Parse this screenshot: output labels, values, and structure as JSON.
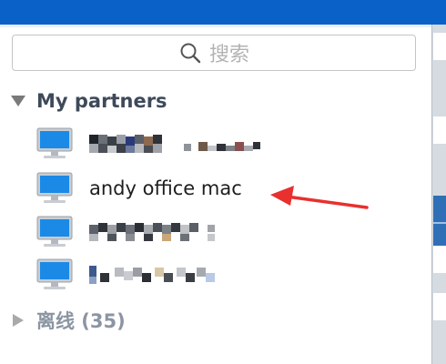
{
  "search": {
    "placeholder": "搜索"
  },
  "partners_group": {
    "label": "My partners",
    "items": [
      {
        "name": "",
        "pixelated": true
      },
      {
        "name": "andy office mac",
        "pixelated": false
      },
      {
        "name": "",
        "pixelated": true
      },
      {
        "name": "",
        "pixelated": true
      }
    ]
  },
  "offline_group": {
    "label": "离线 (35)"
  },
  "colors": {
    "title_bar": "#0a62c9",
    "group_text": "#3e4a5a",
    "offline_text": "#8b95a2",
    "annotation_arrow": "#e8302f",
    "monitor_screen": "#1a8ae6"
  },
  "icons": {
    "search": "search-icon",
    "partner": "monitor-icon",
    "expanded": "triangle-down-icon",
    "collapsed": "triangle-right-icon",
    "annotation": "red-arrow"
  }
}
